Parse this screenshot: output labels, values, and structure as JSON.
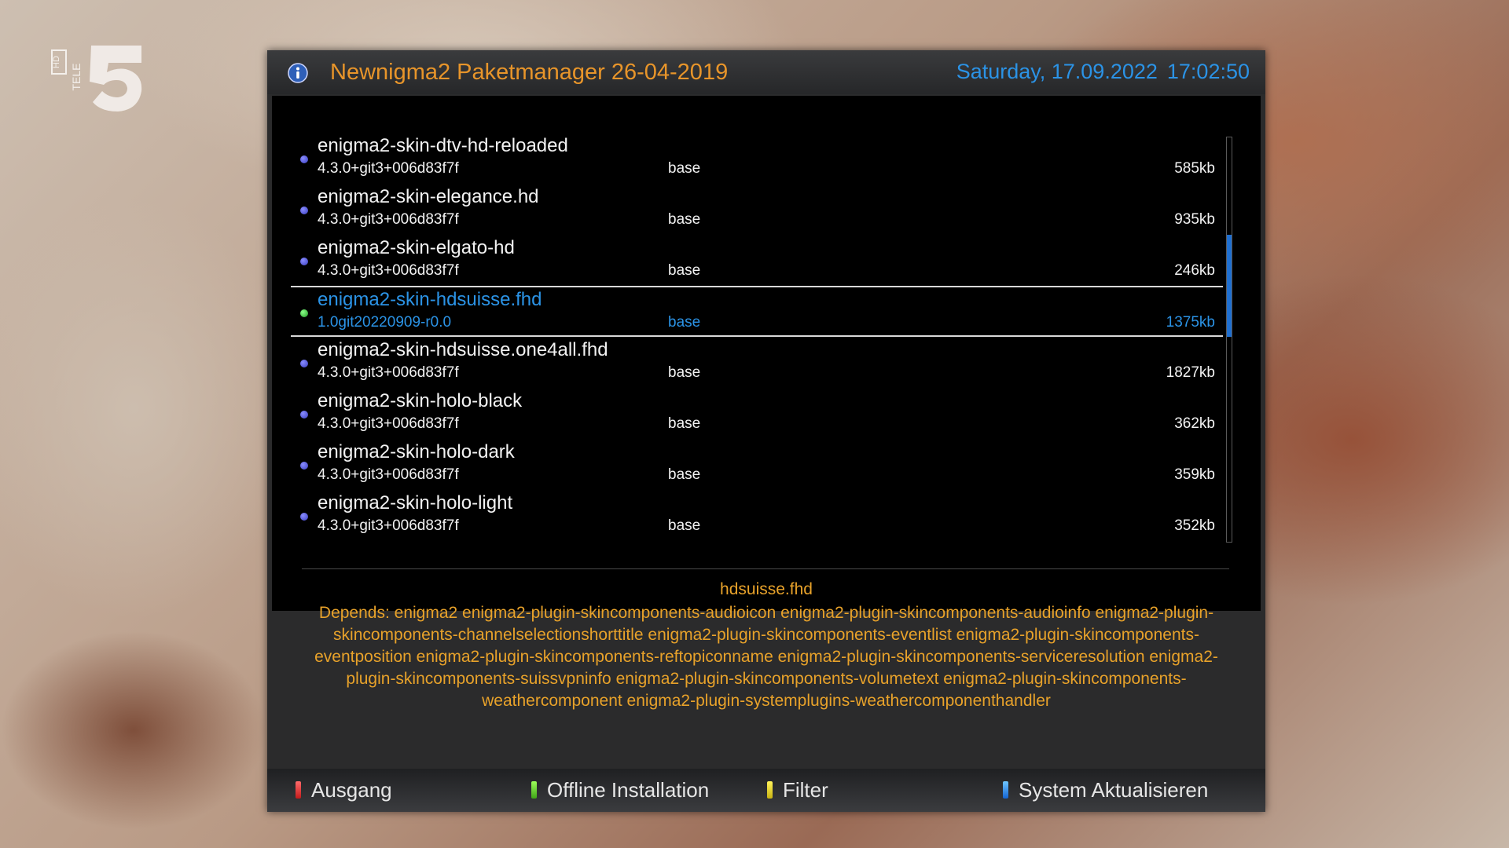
{
  "channel_logo": {
    "icon": "tele5-hd-logo",
    "text_hd": "HD",
    "text_tele": "TELE",
    "text_5": "5"
  },
  "header": {
    "icon": "info-icon",
    "title": "Newnigma2 Paketmanager 26-04-2019",
    "date": "Saturday, 17.09.2022",
    "time": "17:02:50"
  },
  "packages": [
    {
      "name": "enigma2-skin-dtv-hd-reloaded",
      "version": "4.3.0+git3+006d83f7f",
      "section": "base",
      "size": "585kb"
    },
    {
      "name": "enigma2-skin-elegance.hd",
      "version": "4.3.0+git3+006d83f7f",
      "section": "base",
      "size": "935kb"
    },
    {
      "name": "enigma2-skin-elgato-hd",
      "version": "4.3.0+git3+006d83f7f",
      "section": "base",
      "size": "246kb"
    },
    {
      "name": "enigma2-skin-hdsuisse.fhd",
      "version": "1.0git20220909-r0.0",
      "section": "base",
      "size": "1375kb",
      "selected": true
    },
    {
      "name": "enigma2-skin-hdsuisse.one4all.fhd",
      "version": "4.3.0+git3+006d83f7f",
      "section": "base",
      "size": "1827kb"
    },
    {
      "name": "enigma2-skin-holo-black",
      "version": "4.3.0+git3+006d83f7f",
      "section": "base",
      "size": "362kb"
    },
    {
      "name": "enigma2-skin-holo-dark",
      "version": "4.3.0+git3+006d83f7f",
      "section": "base",
      "size": "359kb"
    },
    {
      "name": "enigma2-skin-holo-light",
      "version": "4.3.0+git3+006d83f7f",
      "section": "base",
      "size": "352kb"
    }
  ],
  "scroll_position": 0.3,
  "description": {
    "title": "hdsuisse.fhd",
    "body": "Depends: enigma2 enigma2-plugin-skincomponents-audioicon enigma2-plugin-skincomponents-audioinfo enigma2-plugin-skincomponents-channelselectionshorttitle enigma2-plugin-skincomponents-eventlist enigma2-plugin-skincomponents-eventposition enigma2-plugin-skincomponents-reftopiconname enigma2-plugin-skincomponents-serviceresolution enigma2-plugin-skincomponents-suissvpninfo enigma2-plugin-skincomponents-volumetext enigma2-plugin-skincomponents-weathercomponent enigma2-plugin-systemplugins-weathercomponenthandler"
  },
  "footer": {
    "red": "Ausgang",
    "green": "Offline Installation",
    "yellow": "Filter",
    "blue": "System Aktualisieren"
  },
  "colors": {
    "title": "#e8952a",
    "clock": "#2b93e6",
    "selected": "#2b93e6",
    "description": "#e8a22a"
  }
}
